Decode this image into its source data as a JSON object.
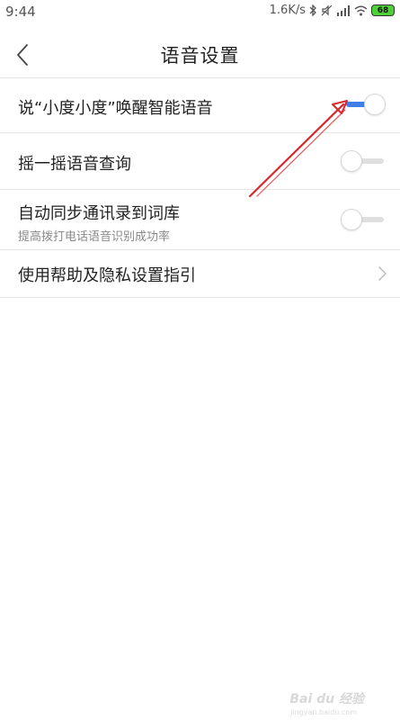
{
  "status_bar": {
    "time": "9:44",
    "network_speed": "1.6K/s",
    "battery": "68"
  },
  "header": {
    "title": "语音设置"
  },
  "settings": [
    {
      "label": "说“小度小度”唤醒智能语音",
      "toggle": "on"
    },
    {
      "label": "摇一摇语音查询",
      "toggle": "off"
    },
    {
      "label": "自动同步通讯录到词库",
      "sublabel": "提高拨打电话语音识别成功率",
      "toggle": "off"
    },
    {
      "label": "使用帮助及隐私设置指引"
    }
  ],
  "colors": {
    "toggle_on": "#3f7fe6",
    "toggle_off": "#e0e0e0",
    "annotation_arrow": "#d9262b"
  },
  "watermark": {
    "text": "Bai du 经验",
    "url": "jingyan.baidu.com"
  }
}
